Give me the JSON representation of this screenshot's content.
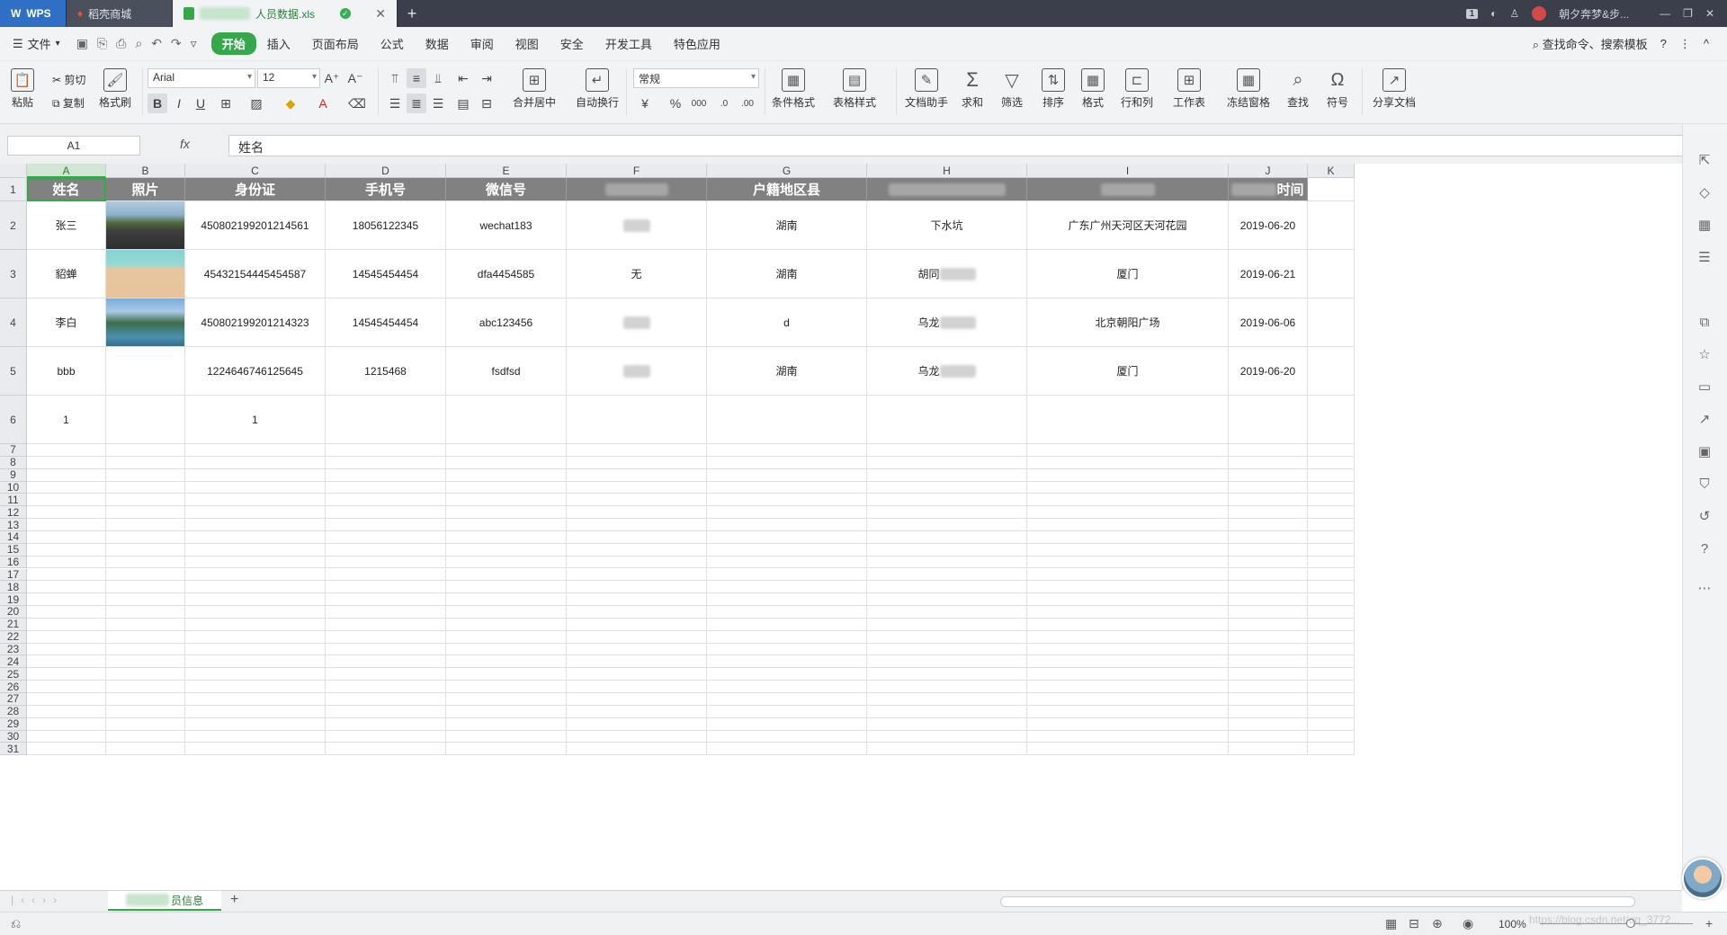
{
  "titlebar": {
    "wps_label": "WPS",
    "store_tab": "稻壳商城",
    "file_tab": "人员数据.xls",
    "new_tab": "+",
    "badge": "1",
    "user_name": "朝夕奔梦&步...",
    "min": "—",
    "max": "❐",
    "close": "✕"
  },
  "menubar": {
    "file_label": "文件",
    "items": [
      "开始",
      "插入",
      "页面布局",
      "公式",
      "数据",
      "审阅",
      "视图",
      "安全",
      "开发工具",
      "特色应用"
    ],
    "search_label": "查找命令、搜索模板",
    "help": "?",
    "more": "⋮",
    "collapse": "^"
  },
  "ribbon": {
    "paste": "粘贴",
    "cut": "剪切",
    "copy": "复制",
    "format_painter": "格式刷",
    "font_name": "Arial",
    "font_size": "12",
    "merge_center": "合并居中",
    "wrap_text": "自动换行",
    "number_format": "常规",
    "conditional_format": "条件格式",
    "table_style": "表格样式",
    "doc_helper": "文档助手",
    "sum": "求和",
    "filter": "筛选",
    "sort": "排序",
    "format": "格式",
    "row_col": "行和列",
    "worksheet": "工作表",
    "freeze": "冻结窗格",
    "find": "查找",
    "symbol": "符号",
    "share": "分享文档"
  },
  "formulabar": {
    "namebox": "A1",
    "fx": "fx",
    "content": "姓名"
  },
  "grid": {
    "columns": [
      "A",
      "B",
      "C",
      "D",
      "E",
      "F",
      "G",
      "H",
      "I",
      "J",
      "K"
    ],
    "header_row": [
      "姓名",
      "照片",
      "身份证",
      "手机号",
      "微信号",
      "",
      "户籍地区县",
      "",
      "",
      "时间",
      ""
    ],
    "rows": [
      [
        "张三",
        "",
        "450802199201214561",
        "18056122345",
        "wechat183",
        "",
        "湖南",
        "下水坑",
        "广东广州天河区天河花园",
        "2019-06-20"
      ],
      [
        "貂蝉",
        "",
        "45432154445454587",
        "14545454454",
        "dfa4454585",
        "无",
        "湖南",
        "胡同",
        "厦门",
        "2019-06-21"
      ],
      [
        "李白",
        "",
        "450802199201214323",
        "14545454454",
        "abc123456",
        "",
        "d",
        "乌龙",
        "北京朝阳广场",
        "2019-06-06"
      ],
      [
        "bbb",
        "",
        "1224646746125645",
        "1215468",
        "fsdfsd",
        "",
        "湖南",
        "乌龙",
        "厦门",
        "2019-06-20"
      ],
      [
        "1",
        "",
        "1",
        "",
        "",
        "",
        "",
        "",
        "",
        ""
      ]
    ],
    "row_numbers": [
      "1",
      "2",
      "3",
      "4",
      "5",
      "6",
      "7",
      "8",
      "9",
      "10",
      "11",
      "12",
      "13",
      "14",
      "15",
      "16",
      "17",
      "18",
      "19",
      "20",
      "21",
      "22",
      "23",
      "24",
      "25",
      "26",
      "27",
      "28",
      "29",
      "30",
      "31"
    ]
  },
  "sheetbar": {
    "sheet_name": "员信息",
    "add_sheet": "+"
  },
  "statusbar": {
    "zoom": "100%",
    "watermark": "https://blog.csdn.net/qq_3772..."
  }
}
